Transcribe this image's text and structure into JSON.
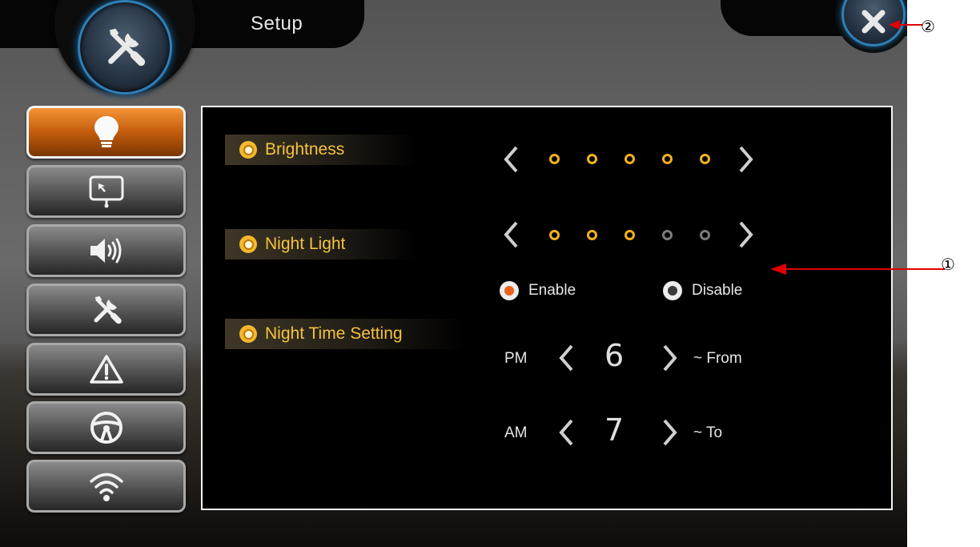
{
  "header": {
    "title": "Setup",
    "setup_icon": "tools-icon",
    "close_icon": "close-icon"
  },
  "sidebar": {
    "items": [
      {
        "name": "display",
        "icon": "bulb-icon",
        "active": true
      },
      {
        "name": "screen",
        "icon": "touch-screen-icon",
        "active": false
      },
      {
        "name": "sound",
        "icon": "speaker-icon",
        "active": false
      },
      {
        "name": "tools",
        "icon": "tools-icon",
        "active": false
      },
      {
        "name": "warning",
        "icon": "warning-icon",
        "active": false
      },
      {
        "name": "steering",
        "icon": "steering-wheel-icon",
        "active": false
      },
      {
        "name": "wireless",
        "icon": "wifi-icon",
        "active": false
      }
    ]
  },
  "settings": {
    "brightness": {
      "label": "Brightness",
      "level": 5,
      "max": 5
    },
    "night_light": {
      "label": "Night Light",
      "level": 3,
      "max": 5
    },
    "night_light_mode": {
      "enable_label": "Enable",
      "disable_label": "Disable",
      "selected": "enable"
    },
    "night_time": {
      "label": "Night Time Setting",
      "from": {
        "period": "PM",
        "hour": "6",
        "suffix": "~ From"
      },
      "to": {
        "period": "AM",
        "hour": "7",
        "suffix": "~ To"
      }
    }
  },
  "annotations": {
    "callout_1": "①",
    "callout_2": "②"
  },
  "colors": {
    "accent": "#f1b21c",
    "active_tab": "#e07a1c",
    "ring_blue": "#2f7fb8",
    "selected_radio": "#e8621e",
    "arrow_red": "#e00000"
  }
}
